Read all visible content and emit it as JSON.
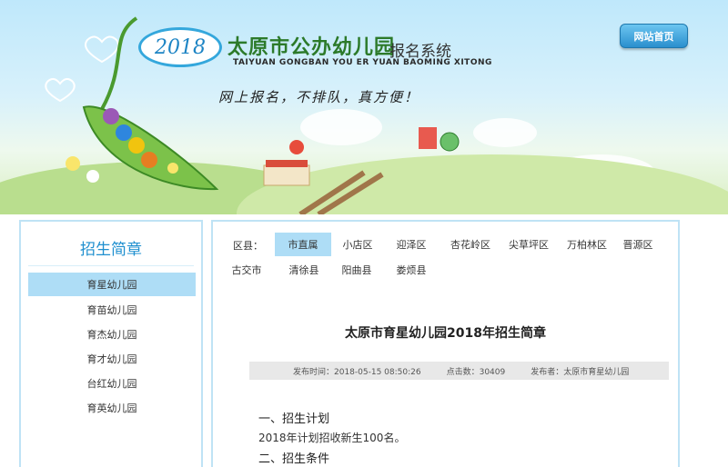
{
  "header": {
    "year": "2018",
    "title": "太原市公办幼儿园",
    "subtitle": "报名系统",
    "pinyin": "TAIYUAN GONGBAN YOU ER YUAN BAOMING XITONG",
    "slogan": "网上报名，不排队，真方便！",
    "home_button": "网站首页"
  },
  "sidebar": {
    "title": "招生简章",
    "items": [
      {
        "label": "育星幼儿园"
      },
      {
        "label": "育苗幼儿园"
      },
      {
        "label": "育杰幼儿园"
      },
      {
        "label": "育才幼儿园"
      },
      {
        "label": "台红幼儿园"
      },
      {
        "label": "育英幼儿园"
      }
    ],
    "active_index": 0
  },
  "content": {
    "district_label": "区县：",
    "districts": [
      {
        "label": "市直属"
      },
      {
        "label": "小店区"
      },
      {
        "label": "迎泽区"
      },
      {
        "label": "杏花岭区"
      },
      {
        "label": "尖草坪区"
      },
      {
        "label": "万柏林区"
      },
      {
        "label": "晋源区"
      },
      {
        "label": "古交市"
      },
      {
        "label": "清徐县"
      },
      {
        "label": "阳曲县"
      },
      {
        "label": "娄烦县"
      }
    ],
    "article": {
      "title": "太原市育星幼儿园2018年招生简章",
      "meta_time": "发布时间：2018-05-15 08:50:26",
      "meta_views": "点击数：30409",
      "meta_author": "发布者：太原市育星幼儿园",
      "section_1": "一、招生计划",
      "para_1": "2018年计划招收新生100名。",
      "section_2": "二、招生条件"
    }
  },
  "colors": {
    "accent_blue": "#1f8fcf",
    "active_bg": "#aeddf6",
    "border": "#bfe3f5",
    "title_green": "#2c7a2a"
  }
}
